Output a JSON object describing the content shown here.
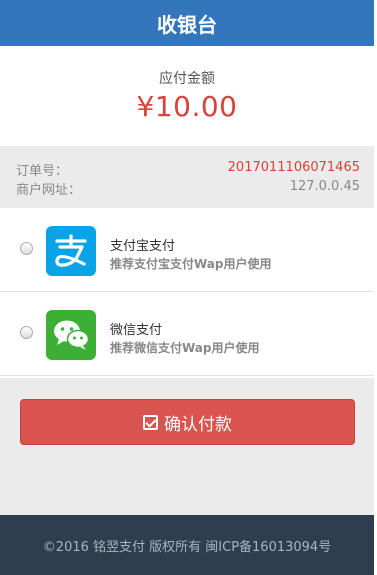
{
  "header": {
    "title": "收银台"
  },
  "amount": {
    "label": "应付金额",
    "value": "¥10.00"
  },
  "order": {
    "order_no_label": "订单号：",
    "order_no": "2017011106071465",
    "merchant_label": "商户网址：",
    "merchant_url": "127.0.0.45"
  },
  "methods": [
    {
      "title": "支付宝支付",
      "desc": "推荐支付宝支付Wap用户使用",
      "icon": "alipay-icon"
    },
    {
      "title": "微信支付",
      "desc": "推荐微信支付Wap用户使用",
      "icon": "wechat-icon"
    }
  ],
  "confirm": {
    "label": "确认付款",
    "icon": "check-square-icon"
  },
  "footer": {
    "text": "©2016 铭翌支付 版权所有 闽ICP备16013094号"
  },
  "colors": {
    "header": "#3376bb",
    "accent": "#d9413b",
    "button": "#d9534f",
    "footer": "#2f3e4f"
  }
}
